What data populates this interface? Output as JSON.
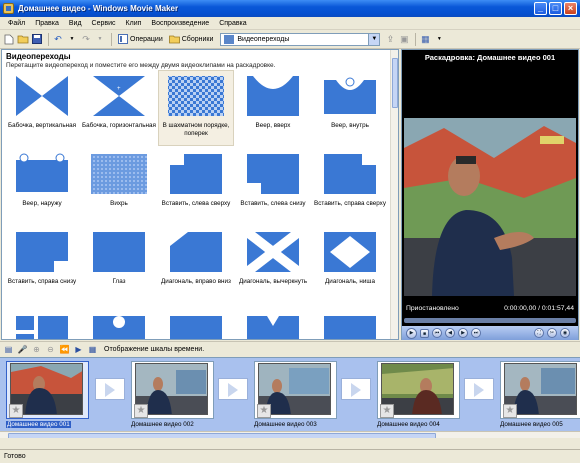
{
  "window": {
    "title": "Домашнее видео - Windows Movie Maker"
  },
  "menu": [
    "Файл",
    "Правка",
    "Вид",
    "Сервис",
    "Клип",
    "Воспроизведение",
    "Справка"
  ],
  "toolbar": {
    "operations_label": "Операции",
    "collections_label": "Сборники",
    "collection_value": "Видеопереходы"
  },
  "content": {
    "title": "Видеопереходы",
    "hint": "Перетащите видеопереход и поместите его между двумя видеоклипами на раскадровке.",
    "transitions": [
      {
        "label": "Бабочка, вертикальная",
        "icon": "butterfly-vertical"
      },
      {
        "label": "Бабочка, горизонтальная",
        "icon": "butterfly-horizontal"
      },
      {
        "label": "В шахматном порядке, поперек",
        "icon": "checkerboard",
        "selected": true
      },
      {
        "label": "Веер, вверх",
        "icon": "fan-up"
      },
      {
        "label": "Веер, внутрь",
        "icon": "fan-in"
      },
      {
        "label": "Веер, наружу",
        "icon": "fan-out"
      },
      {
        "label": "Вихрь",
        "icon": "whirlwind"
      },
      {
        "label": "Вставить, слева сверху",
        "icon": "insert-top-left"
      },
      {
        "label": "Вставить, слева снизу",
        "icon": "insert-bottom-left"
      },
      {
        "label": "Вставить, справа сверху",
        "icon": "insert-top-right"
      },
      {
        "label": "Вставить, справа снизу",
        "icon": "insert-bottom-right"
      },
      {
        "label": "Глаз",
        "icon": "eye"
      },
      {
        "label": "Диагональ, вправо вниз",
        "icon": "diagonal-down-right"
      },
      {
        "label": "Диагональ, вычеркнуть",
        "icon": "diagonal-cross"
      },
      {
        "label": "Диагональ, ниша",
        "icon": "diagonal-box"
      }
    ]
  },
  "preview": {
    "title": "Раскадровка: Домашнее видео 001",
    "status": "Приостановлено",
    "time": "0:00:00,00 / 0:01:57,44"
  },
  "storyboard_toolbar": {
    "label": "Отображение шкалы времени."
  },
  "storyboard": {
    "clips": [
      {
        "label": "Домашнее видео 001",
        "selected": true
      },
      {
        "label": "Домашнее видео 002"
      },
      {
        "label": "Домашнее видео 003"
      },
      {
        "label": "Домашнее видео 004"
      },
      {
        "label": "Домашнее видео 005"
      }
    ]
  },
  "statusbar": {
    "text": "Готово"
  },
  "colors": {
    "accent": "#3a78d4",
    "storyboard_bg": "#a9c1ee",
    "title_bar": "#0a58d8"
  }
}
